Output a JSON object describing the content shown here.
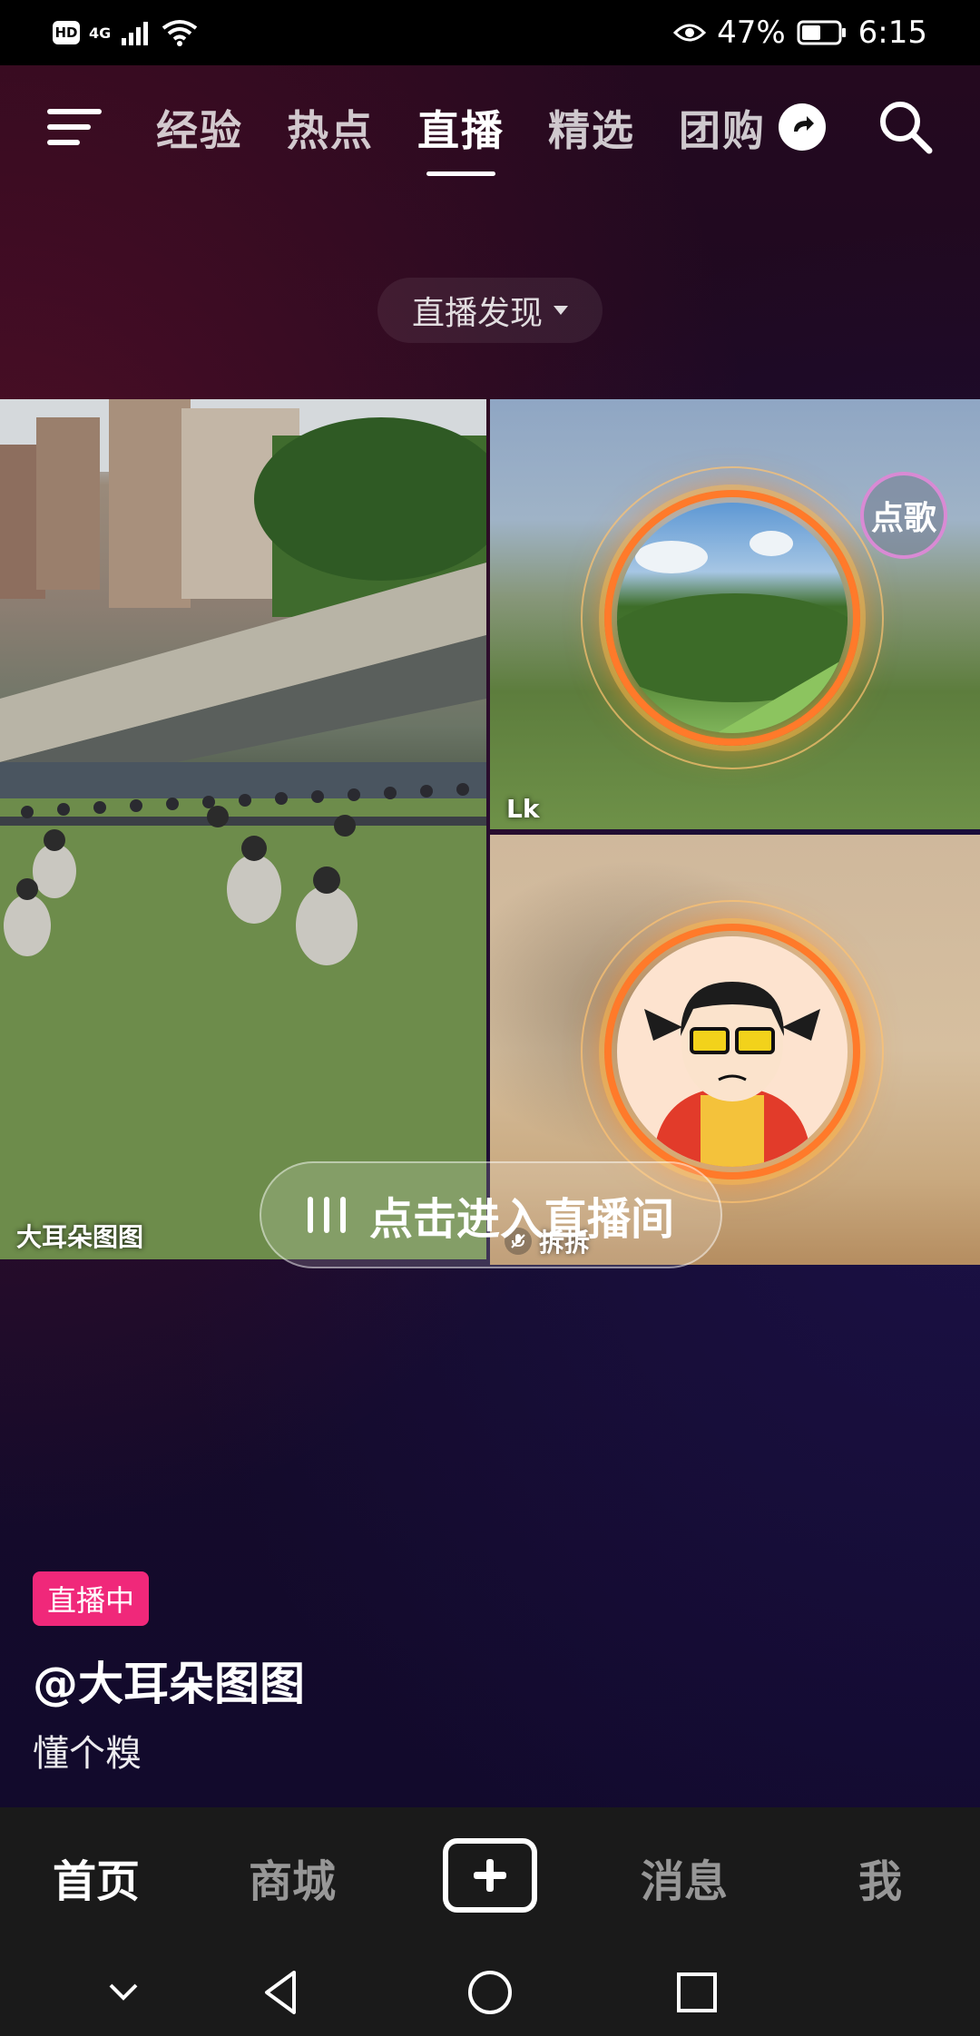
{
  "status_bar": {
    "left_badge": "HD",
    "network": "4G",
    "battery_percent": "47%",
    "time": "6:15"
  },
  "top_nav": {
    "tabs": [
      {
        "label": "经验",
        "active": false
      },
      {
        "label": "热点",
        "active": false
      },
      {
        "label": "直播",
        "active": true
      },
      {
        "label": "精选",
        "active": false
      },
      {
        "label": "团购",
        "active": false
      }
    ]
  },
  "discover": {
    "label": "直播发现"
  },
  "tiles": {
    "left": {
      "name": "大耳朵图图"
    },
    "right_top": {
      "name": "Lk",
      "badge": "点歌"
    },
    "right_bottom": {
      "name": "拆拆"
    }
  },
  "enter_button": {
    "label": "点击进入直播间"
  },
  "live_info": {
    "badge": "直播中",
    "host": "@大耳朵图图",
    "title": "懂个糗"
  },
  "bottom_nav": {
    "items": [
      {
        "label": "首页",
        "active": true
      },
      {
        "label": "商城",
        "active": false
      },
      {
        "label": "消息",
        "active": false
      },
      {
        "label": "我",
        "active": false
      }
    ]
  },
  "colors": {
    "live_badge": "#f0287a",
    "ring": "#ff7a2a",
    "background": "#150b2a"
  }
}
